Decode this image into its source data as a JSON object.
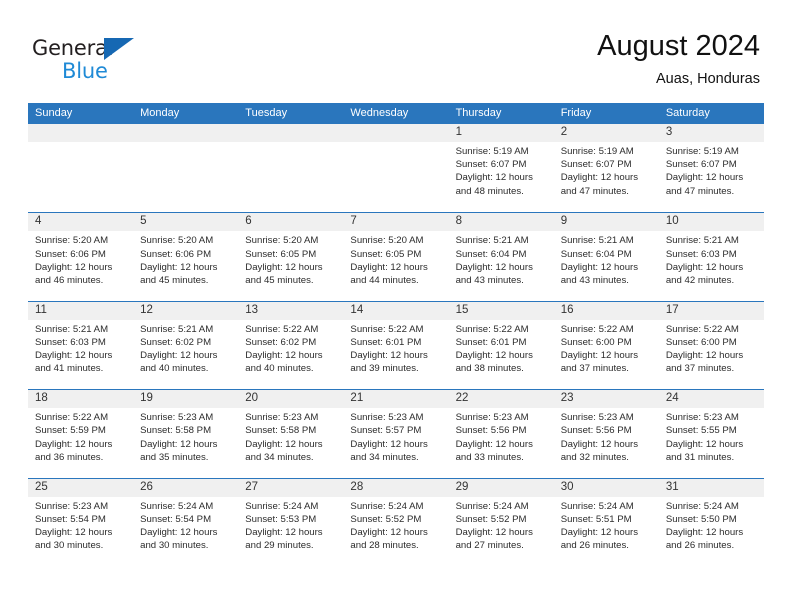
{
  "brand": {
    "name_part1": "General",
    "name_part2": "Blue",
    "accent_color": "#1668b3",
    "blue_text_color": "#1f8ad6"
  },
  "header": {
    "title": "August 2024",
    "subtitle": "Auas, Honduras"
  },
  "theme": {
    "header_blue": "#2a76bd",
    "date_band_gray": "#f0f0f0",
    "text_color": "#2c2c2c"
  },
  "weekdays": [
    "Sunday",
    "Monday",
    "Tuesday",
    "Wednesday",
    "Thursday",
    "Friday",
    "Saturday"
  ],
  "weeks": [
    {
      "days": [
        {
          "date": "",
          "sunrise": "",
          "sunset": "",
          "daylight_l1": "",
          "daylight_l2": "",
          "empty": true
        },
        {
          "date": "",
          "sunrise": "",
          "sunset": "",
          "daylight_l1": "",
          "daylight_l2": "",
          "empty": true
        },
        {
          "date": "",
          "sunrise": "",
          "sunset": "",
          "daylight_l1": "",
          "daylight_l2": "",
          "empty": true
        },
        {
          "date": "",
          "sunrise": "",
          "sunset": "",
          "daylight_l1": "",
          "daylight_l2": "",
          "empty": true
        },
        {
          "date": "1",
          "sunrise": "Sunrise: 5:19 AM",
          "sunset": "Sunset: 6:07 PM",
          "daylight_l1": "Daylight: 12 hours",
          "daylight_l2": "and 48 minutes.",
          "empty": false
        },
        {
          "date": "2",
          "sunrise": "Sunrise: 5:19 AM",
          "sunset": "Sunset: 6:07 PM",
          "daylight_l1": "Daylight: 12 hours",
          "daylight_l2": "and 47 minutes.",
          "empty": false
        },
        {
          "date": "3",
          "sunrise": "Sunrise: 5:19 AM",
          "sunset": "Sunset: 6:07 PM",
          "daylight_l1": "Daylight: 12 hours",
          "daylight_l2": "and 47 minutes.",
          "empty": false
        }
      ]
    },
    {
      "days": [
        {
          "date": "4",
          "sunrise": "Sunrise: 5:20 AM",
          "sunset": "Sunset: 6:06 PM",
          "daylight_l1": "Daylight: 12 hours",
          "daylight_l2": "and 46 minutes.",
          "empty": false
        },
        {
          "date": "5",
          "sunrise": "Sunrise: 5:20 AM",
          "sunset": "Sunset: 6:06 PM",
          "daylight_l1": "Daylight: 12 hours",
          "daylight_l2": "and 45 minutes.",
          "empty": false
        },
        {
          "date": "6",
          "sunrise": "Sunrise: 5:20 AM",
          "sunset": "Sunset: 6:05 PM",
          "daylight_l1": "Daylight: 12 hours",
          "daylight_l2": "and 45 minutes.",
          "empty": false
        },
        {
          "date": "7",
          "sunrise": "Sunrise: 5:20 AM",
          "sunset": "Sunset: 6:05 PM",
          "daylight_l1": "Daylight: 12 hours",
          "daylight_l2": "and 44 minutes.",
          "empty": false
        },
        {
          "date": "8",
          "sunrise": "Sunrise: 5:21 AM",
          "sunset": "Sunset: 6:04 PM",
          "daylight_l1": "Daylight: 12 hours",
          "daylight_l2": "and 43 minutes.",
          "empty": false
        },
        {
          "date": "9",
          "sunrise": "Sunrise: 5:21 AM",
          "sunset": "Sunset: 6:04 PM",
          "daylight_l1": "Daylight: 12 hours",
          "daylight_l2": "and 43 minutes.",
          "empty": false
        },
        {
          "date": "10",
          "sunrise": "Sunrise: 5:21 AM",
          "sunset": "Sunset: 6:03 PM",
          "daylight_l1": "Daylight: 12 hours",
          "daylight_l2": "and 42 minutes.",
          "empty": false
        }
      ]
    },
    {
      "days": [
        {
          "date": "11",
          "sunrise": "Sunrise: 5:21 AM",
          "sunset": "Sunset: 6:03 PM",
          "daylight_l1": "Daylight: 12 hours",
          "daylight_l2": "and 41 minutes.",
          "empty": false
        },
        {
          "date": "12",
          "sunrise": "Sunrise: 5:21 AM",
          "sunset": "Sunset: 6:02 PM",
          "daylight_l1": "Daylight: 12 hours",
          "daylight_l2": "and 40 minutes.",
          "empty": false
        },
        {
          "date": "13",
          "sunrise": "Sunrise: 5:22 AM",
          "sunset": "Sunset: 6:02 PM",
          "daylight_l1": "Daylight: 12 hours",
          "daylight_l2": "and 40 minutes.",
          "empty": false
        },
        {
          "date": "14",
          "sunrise": "Sunrise: 5:22 AM",
          "sunset": "Sunset: 6:01 PM",
          "daylight_l1": "Daylight: 12 hours",
          "daylight_l2": "and 39 minutes.",
          "empty": false
        },
        {
          "date": "15",
          "sunrise": "Sunrise: 5:22 AM",
          "sunset": "Sunset: 6:01 PM",
          "daylight_l1": "Daylight: 12 hours",
          "daylight_l2": "and 38 minutes.",
          "empty": false
        },
        {
          "date": "16",
          "sunrise": "Sunrise: 5:22 AM",
          "sunset": "Sunset: 6:00 PM",
          "daylight_l1": "Daylight: 12 hours",
          "daylight_l2": "and 37 minutes.",
          "empty": false
        },
        {
          "date": "17",
          "sunrise": "Sunrise: 5:22 AM",
          "sunset": "Sunset: 6:00 PM",
          "daylight_l1": "Daylight: 12 hours",
          "daylight_l2": "and 37 minutes.",
          "empty": false
        }
      ]
    },
    {
      "days": [
        {
          "date": "18",
          "sunrise": "Sunrise: 5:22 AM",
          "sunset": "Sunset: 5:59 PM",
          "daylight_l1": "Daylight: 12 hours",
          "daylight_l2": "and 36 minutes.",
          "empty": false
        },
        {
          "date": "19",
          "sunrise": "Sunrise: 5:23 AM",
          "sunset": "Sunset: 5:58 PM",
          "daylight_l1": "Daylight: 12 hours",
          "daylight_l2": "and 35 minutes.",
          "empty": false
        },
        {
          "date": "20",
          "sunrise": "Sunrise: 5:23 AM",
          "sunset": "Sunset: 5:58 PM",
          "daylight_l1": "Daylight: 12 hours",
          "daylight_l2": "and 34 minutes.",
          "empty": false
        },
        {
          "date": "21",
          "sunrise": "Sunrise: 5:23 AM",
          "sunset": "Sunset: 5:57 PM",
          "daylight_l1": "Daylight: 12 hours",
          "daylight_l2": "and 34 minutes.",
          "empty": false
        },
        {
          "date": "22",
          "sunrise": "Sunrise: 5:23 AM",
          "sunset": "Sunset: 5:56 PM",
          "daylight_l1": "Daylight: 12 hours",
          "daylight_l2": "and 33 minutes.",
          "empty": false
        },
        {
          "date": "23",
          "sunrise": "Sunrise: 5:23 AM",
          "sunset": "Sunset: 5:56 PM",
          "daylight_l1": "Daylight: 12 hours",
          "daylight_l2": "and 32 minutes.",
          "empty": false
        },
        {
          "date": "24",
          "sunrise": "Sunrise: 5:23 AM",
          "sunset": "Sunset: 5:55 PM",
          "daylight_l1": "Daylight: 12 hours",
          "daylight_l2": "and 31 minutes.",
          "empty": false
        }
      ]
    },
    {
      "days": [
        {
          "date": "25",
          "sunrise": "Sunrise: 5:23 AM",
          "sunset": "Sunset: 5:54 PM",
          "daylight_l1": "Daylight: 12 hours",
          "daylight_l2": "and 30 minutes.",
          "empty": false
        },
        {
          "date": "26",
          "sunrise": "Sunrise: 5:24 AM",
          "sunset": "Sunset: 5:54 PM",
          "daylight_l1": "Daylight: 12 hours",
          "daylight_l2": "and 30 minutes.",
          "empty": false
        },
        {
          "date": "27",
          "sunrise": "Sunrise: 5:24 AM",
          "sunset": "Sunset: 5:53 PM",
          "daylight_l1": "Daylight: 12 hours",
          "daylight_l2": "and 29 minutes.",
          "empty": false
        },
        {
          "date": "28",
          "sunrise": "Sunrise: 5:24 AM",
          "sunset": "Sunset: 5:52 PM",
          "daylight_l1": "Daylight: 12 hours",
          "daylight_l2": "and 28 minutes.",
          "empty": false
        },
        {
          "date": "29",
          "sunrise": "Sunrise: 5:24 AM",
          "sunset": "Sunset: 5:52 PM",
          "daylight_l1": "Daylight: 12 hours",
          "daylight_l2": "and 27 minutes.",
          "empty": false
        },
        {
          "date": "30",
          "sunrise": "Sunrise: 5:24 AM",
          "sunset": "Sunset: 5:51 PM",
          "daylight_l1": "Daylight: 12 hours",
          "daylight_l2": "and 26 minutes.",
          "empty": false
        },
        {
          "date": "31",
          "sunrise": "Sunrise: 5:24 AM",
          "sunset": "Sunset: 5:50 PM",
          "daylight_l1": "Daylight: 12 hours",
          "daylight_l2": "and 26 minutes.",
          "empty": false
        }
      ]
    }
  ]
}
